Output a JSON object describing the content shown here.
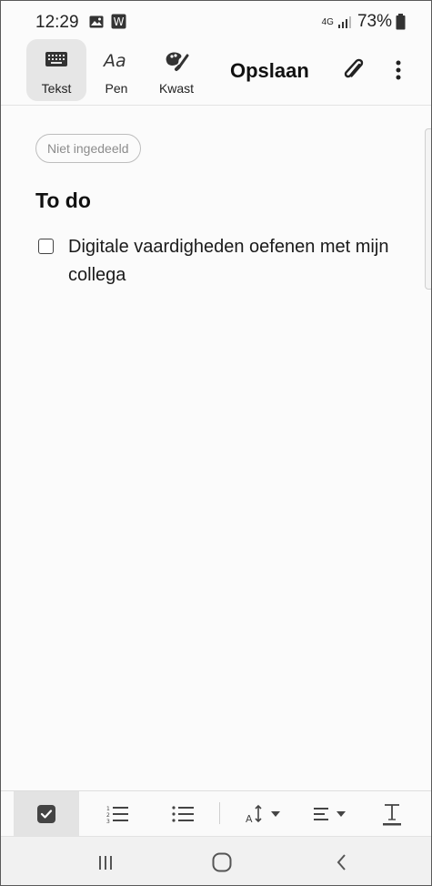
{
  "status_bar": {
    "time": "12:29",
    "network": "4G",
    "battery": "73%",
    "icons": [
      "gallery-icon",
      "w-app-icon",
      "signal-icon",
      "battery-icon"
    ]
  },
  "toolbar": {
    "tools": [
      {
        "label": "Tekst",
        "icon": "keyboard-icon",
        "active": true
      },
      {
        "label": "Pen",
        "icon": "handwriting-icon",
        "active": false
      },
      {
        "label": "Kwast",
        "icon": "brush-icon",
        "active": false
      }
    ],
    "save_label": "Opslaan",
    "attach_icon": "paperclip-icon",
    "more_icon": "more-vert-icon"
  },
  "note": {
    "category": "Niet ingedeeld",
    "title": "To do",
    "tasks": [
      {
        "text": "Digitale vaardigheden oefenen met mijn collega",
        "checked": false
      }
    ]
  },
  "format_bar": {
    "items": [
      "checkbox-icon",
      "numbered-list-icon",
      "bullet-list-icon",
      "text-size-icon",
      "align-icon",
      "text-style-icon"
    ],
    "active_item": "checkbox-icon"
  },
  "nav_bar": {
    "items": [
      "recents-icon",
      "home-icon",
      "back-icon"
    ]
  },
  "colors": {
    "background": "#fbfbfb",
    "active_tool": "#e6e6e6",
    "text": "#111111",
    "muted": "#8c8c8c"
  }
}
